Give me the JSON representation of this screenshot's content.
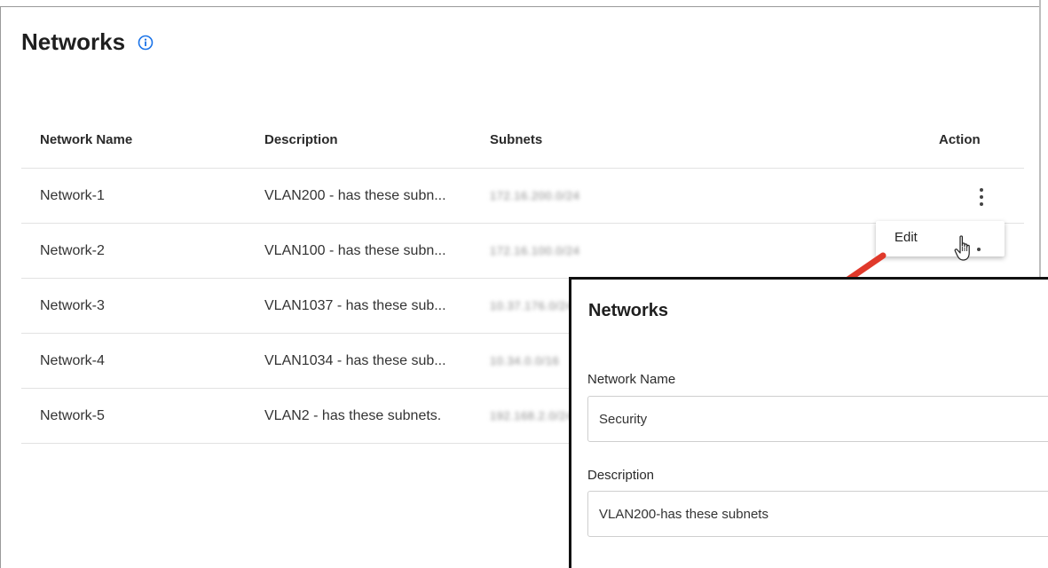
{
  "page": {
    "title": "Networks"
  },
  "table": {
    "headers": {
      "name": "Network Name",
      "description": "Description",
      "subnets": "Subnets",
      "action": "Action"
    },
    "rows": [
      {
        "name": "Network-1",
        "description": "VLAN200 - has these subn...",
        "subnets": "172.16.200.0/24"
      },
      {
        "name": "Network-2",
        "description": "VLAN100 - has these subn...",
        "subnets": "172.16.100.0/24"
      },
      {
        "name": "Network-3",
        "description": "VLAN1037 - has these sub...",
        "subnets": "10.37.176.0/24"
      },
      {
        "name": "Network-4",
        "description": "VLAN1034 - has these sub...",
        "subnets": "10.34.0.0/16"
      },
      {
        "name": "Network-5",
        "description": "VLAN2 - has these subnets.",
        "subnets": "192.168.2.0/24"
      }
    ]
  },
  "action_menu": {
    "edit_label": "Edit"
  },
  "dialog": {
    "title": "Networks",
    "name_label": "Network Name",
    "name_value": "Security",
    "description_label": "Description",
    "description_value": "VLAN200-has these subnets"
  },
  "colors": {
    "info_icon": "#1a73e8",
    "arrow": "#e0392b"
  }
}
